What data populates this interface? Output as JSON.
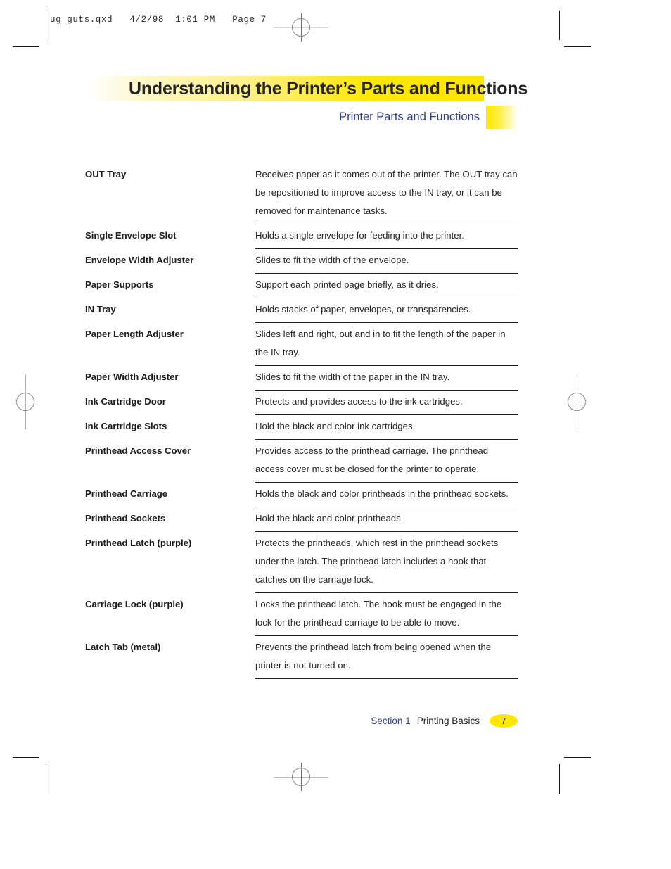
{
  "slug": {
    "text": "ug_guts.qxd   4/2/98  1:01 PM   Page 7"
  },
  "header": {
    "title": "Understanding the Printer’s Parts and Functions",
    "subtitle": "Printer Parts and Functions",
    "banner_color": "#ffe800",
    "subtitle_color": "#2f3d8e"
  },
  "parts_table": {
    "rows": [
      {
        "term": "OUT Tray",
        "description": "Receives paper as it comes out of the printer. The OUT tray can be repositioned to improve access to the IN tray, or it can be removed for maintenance tasks."
      },
      {
        "term": "Single Envelope Slot",
        "description": "Holds a single envelope for feeding into the printer."
      },
      {
        "term": "Envelope Width Adjuster",
        "description": "Slides to fit the width of the envelope."
      },
      {
        "term": "Paper Supports",
        "description": "Support each printed page briefly, as it dries."
      },
      {
        "term": "IN Tray",
        "description": "Holds stacks of paper, envelopes, or transparencies."
      },
      {
        "term": "Paper Length Adjuster",
        "description": "Slides left and right, out and in to fit the length of the paper in the IN tray."
      },
      {
        "term": "Paper Width Adjuster",
        "description": "Slides to fit the width of the paper in the IN tray."
      },
      {
        "term": "Ink Cartridge Door",
        "description": "Protects and provides access to the ink cartridges."
      },
      {
        "term": "Ink Cartridge Slots",
        "description": "Hold the black and color ink cartridges."
      },
      {
        "term": "Printhead Access Cover",
        "description": "Provides access to the printhead carriage. The printhead access cover must be closed for the printer to operate."
      },
      {
        "term": "Printhead Carriage",
        "description": "Holds the black and color printheads in the printhead sockets."
      },
      {
        "term": "Printhead Sockets",
        "description": "Hold the black and color printheads."
      },
      {
        "term": "Printhead Latch (purple)",
        "description": "Protects the printheads, which rest in the printhead sockets under the latch. The printhead latch includes a hook that catches on the carriage lock."
      },
      {
        "term": "Carriage Lock (purple)",
        "description": "Locks the printhead latch. The hook must be engaged in the lock for the printhead carriage to be able to move."
      },
      {
        "term": "Latch Tab (metal)",
        "description": "Prevents the printhead latch from being opened when the printer is not turned on."
      }
    ]
  },
  "footer": {
    "section": "Section 1",
    "chapter": "Printing Basics",
    "page_number": "7",
    "badge_color": "#ffe800"
  }
}
